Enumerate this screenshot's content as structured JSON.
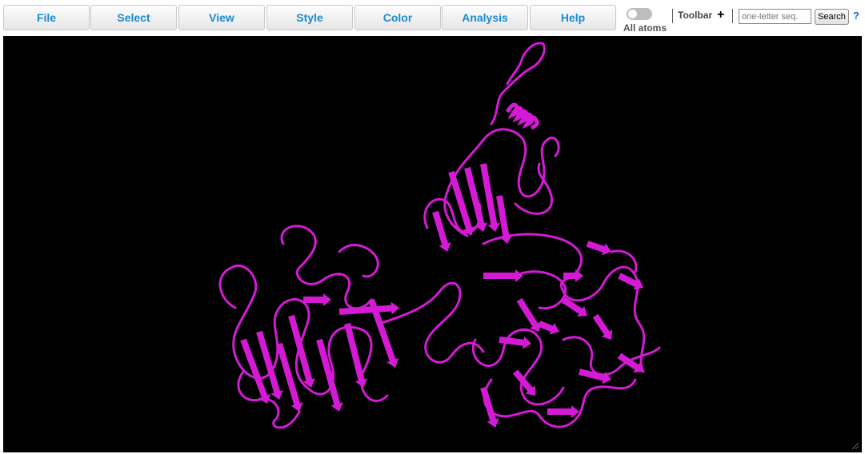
{
  "menu": {
    "items": [
      {
        "label": "File"
      },
      {
        "label": "Select"
      },
      {
        "label": "View"
      },
      {
        "label": "Style"
      },
      {
        "label": "Color"
      },
      {
        "label": "Analysis"
      },
      {
        "label": "Help"
      }
    ]
  },
  "toolbar": {
    "all_atoms_label": "All atoms",
    "all_atoms_on": false,
    "toolbar_label": "Toolbar",
    "plus_icon": "+",
    "seq_placeholder": "one-letter seq.",
    "search_label": "Search",
    "help_icon": "?"
  },
  "viewer": {
    "background": "#000000",
    "cartoon_color": "#d41ad4",
    "style": "cartoon"
  }
}
